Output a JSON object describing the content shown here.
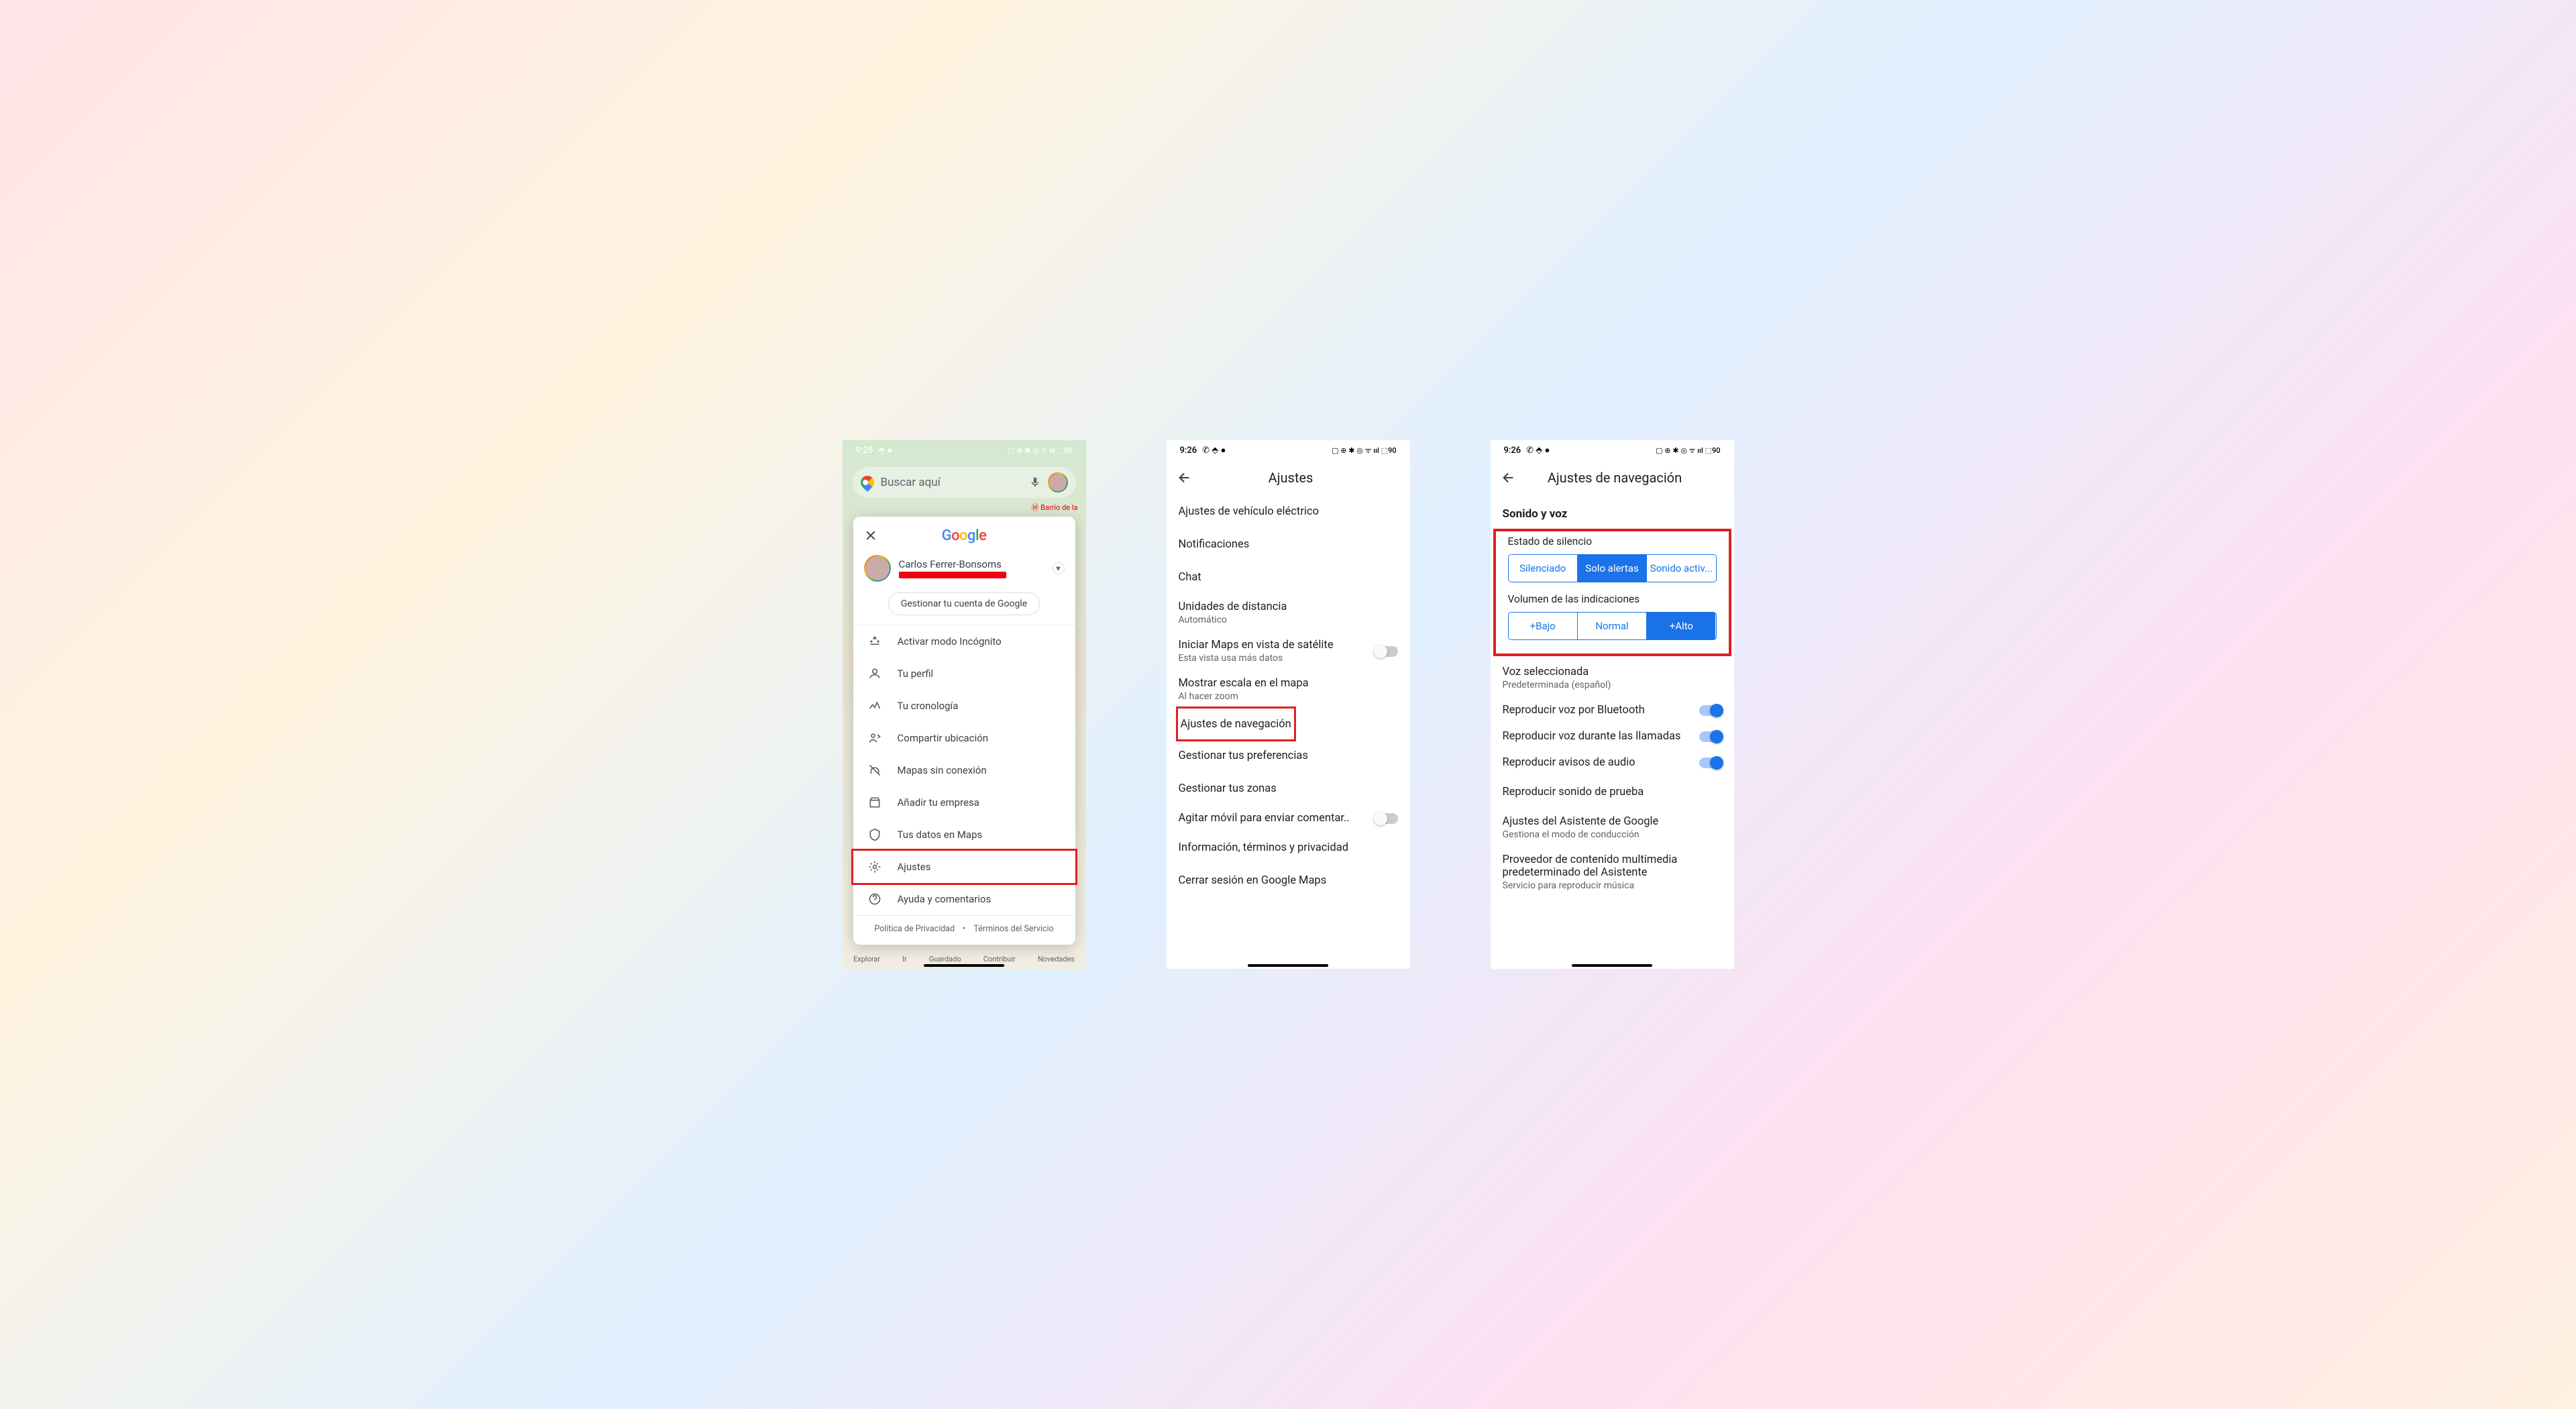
{
  "phone1": {
    "status": {
      "time": "9:25",
      "icons": "⬘ ●",
      "right": "▢ ⊕ ✱ ◎ ᯤ ııl ⬚90"
    },
    "search_placeholder": "Buscar aquí",
    "metro": "Ⓜ Barrio de la",
    "logo": "Google",
    "account_name": "Carlos Ferrer-Bonsoms",
    "manage_btn": "Gestionar tu cuenta de Google",
    "menu": {
      "incognito": "Activar modo Incógnito",
      "profile": "Tu perfil",
      "timeline": "Tu cronología",
      "share": "Compartir ubicación",
      "offline": "Mapas sin conexión",
      "business": "Añadir tu empresa",
      "data": "Tus datos en Maps",
      "settings": "Ajustes",
      "help": "Ayuda y comentarios"
    },
    "footer": {
      "privacy": "Política de Privacidad",
      "terms": "Términos del Servicio"
    },
    "bottomnav": {
      "explore": "Explorar",
      "go": "Ir",
      "saved": "Guardado",
      "contribute": "Contribuir",
      "news": "Novedades"
    }
  },
  "phone2": {
    "status": {
      "time": "9:26",
      "icons": "✆ ⬘ ●",
      "right": "▢ ⊕ ✱ ◎ ᯤ ııl ⬚90"
    },
    "title": "Ajustes",
    "items": {
      "ev": "Ajustes de vehículo eléctrico",
      "notif": "Notificaciones",
      "chat": "Chat",
      "units": "Unidades de distancia",
      "units_sub": "Automático",
      "sat": "Iniciar Maps en vista de satélite",
      "sat_sub": "Esta vista usa más datos",
      "scale": "Mostrar escala en el mapa",
      "scale_sub": "Al hacer zoom",
      "nav": "Ajustes de navegación",
      "prefs": "Gestionar tus preferencias",
      "zones": "Gestionar tus zonas",
      "shake": "Agitar móvil para enviar comentar..",
      "info": "Información, términos y privacidad",
      "logout": "Cerrar sesión en Google Maps"
    }
  },
  "phone3": {
    "status": {
      "time": "9:26",
      "icons": "✆ ⬘ ●",
      "right": "▢ ⊕ ✱ ◎ ᯤ ııl ⬚90"
    },
    "title": "Ajustes de navegación",
    "section": "Sonido y voz",
    "mute_label": "Estado de silencio",
    "mute_opts": {
      "a": "Silenciado",
      "b": "Solo alertas",
      "c": "Sonido activ..."
    },
    "vol_label": "Volumen de las indicaciones",
    "vol_opts": {
      "a": "+Bajo",
      "b": "Normal",
      "c": "+Alto"
    },
    "voice": "Voz seleccionada",
    "voice_sub": "Predeterminada (español)",
    "bt": "Reproducir voz por Bluetooth",
    "calls": "Reproducir voz durante las llamadas",
    "audio": "Reproducir avisos de audio",
    "test": "Reproducir sonido de prueba",
    "assistant": "Ajustes del Asistente de Google",
    "assistant_sub": "Gestiona el modo de conducción",
    "media": "Proveedor de contenido multimedia predeterminado del Asistente",
    "media_sub": "Servicio para reproducir música"
  }
}
